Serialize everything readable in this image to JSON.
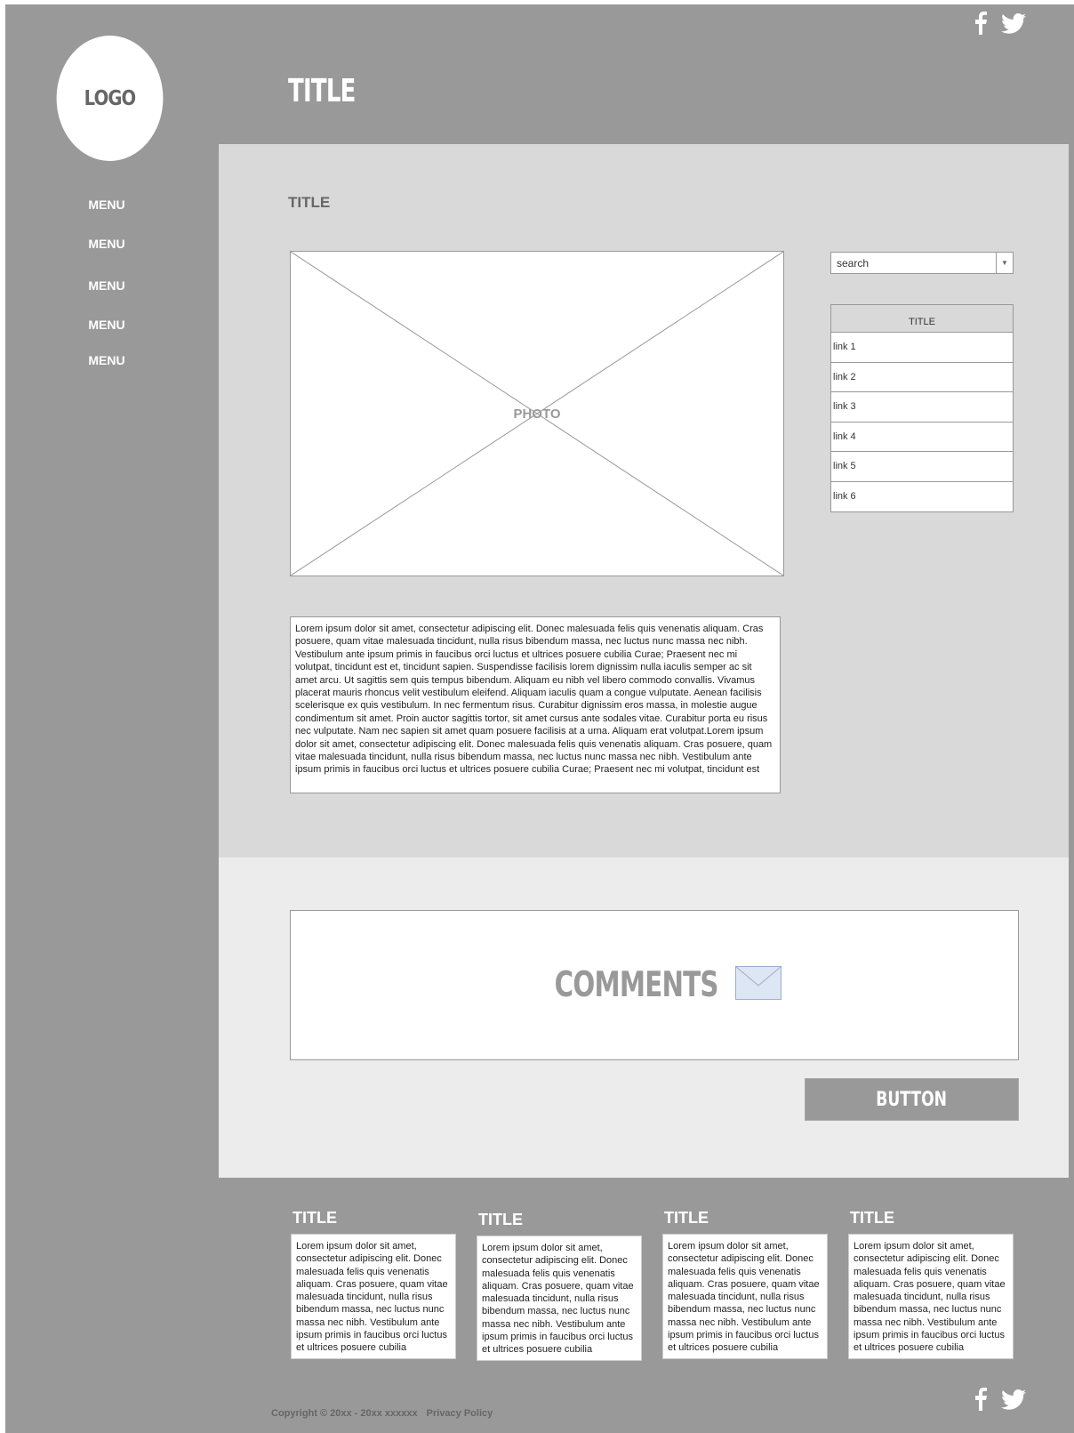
{
  "header": {
    "title": "TITLE",
    "logo": "LOGO"
  },
  "sidebar": {
    "items": [
      {
        "label": "MENU"
      },
      {
        "label": "MENU"
      },
      {
        "label": "MENU"
      },
      {
        "label": "MENU"
      },
      {
        "label": "MENU"
      }
    ]
  },
  "social": {
    "icons": [
      "facebook-icon",
      "twitter-icon"
    ]
  },
  "main": {
    "title": "TITLE",
    "photo_label": "PHOTO",
    "search": {
      "value": "search"
    },
    "links_panel": {
      "title": "TITLE",
      "links": [
        "link 1",
        "link 2",
        "link 3",
        "link 4",
        "link 5",
        "link 6"
      ]
    },
    "body_text": "Lorem ipsum dolor sit amet, consectetur adipiscing elit. Donec malesuada felis quis venenatis aliquam. Cras posuere, quam vitae malesuada tincidunt, nulla risus bibendum massa, nec luctus nunc massa nec nibh. Vestibulum ante ipsum primis in faucibus orci luctus et ultrices posuere cubilia Curae; Praesent nec mi volutpat, tincidunt est et, tincidunt sapien. Suspendisse facilisis lorem dignissim nulla iaculis semper ac sit amet arcu. Ut sagittis sem quis tempus bibendum. Aliquam eu nibh vel libero commodo convallis. Vivamus placerat mauris rhoncus velit vestibulum eleifend. Aliquam iaculis quam a congue vulputate. Aenean facilisis scelerisque ex quis vestibulum. In nec fermentum risus. Curabitur dignissim eros massa, in molestie augue condimentum sit amet. Proin auctor sagittis tortor, sit amet cursus ante sodales vitae. Curabitur porta eu risus nec vulputate. Nam nec sapien sit amet quam posuere facilisis at a urna. Aliquam erat volutpat.Lorem ipsum dolor sit amet, consectetur adipiscing elit. Donec malesuada felis quis venenatis aliquam. Cras posuere, quam vitae malesuada tincidunt, nulla risus bibendum massa, nec luctus nunc massa nec nibh. Vestibulum ante ipsum primis in faucibus orci luctus et ultrices posuere cubilia Curae; Praesent nec mi volutpat, tincidunt est"
  },
  "comments": {
    "label": "COMMENTS",
    "icon": "envelope-icon",
    "button_label": "BUTTON"
  },
  "footer": {
    "columns": [
      {
        "title": "TITLE",
        "text": "Lorem ipsum dolor sit amet, consectetur adipiscing elit. Donec malesuada felis quis venenatis aliquam. Cras posuere, quam vitae malesuada tincidunt, nulla risus bibendum massa, nec luctus nunc massa nec nibh. Vestibulum ante ipsum primis in faucibus orci luctus et ultrices posuere cubilia"
      },
      {
        "title": "TITLE",
        "text": "Lorem ipsum dolor sit amet, consectetur adipiscing elit. Donec malesuada felis quis venenatis aliquam. Cras posuere, quam vitae malesuada tincidunt, nulla risus bibendum massa, nec luctus nunc massa nec nibh. Vestibulum ante ipsum primis in faucibus orci luctus et ultrices posuere cubilia"
      },
      {
        "title": "TITLE",
        "text": "Lorem ipsum dolor sit amet, consectetur adipiscing elit. Donec malesuada felis quis venenatis aliquam. Cras posuere, quam vitae malesuada tincidunt, nulla risus bibendum massa, nec luctus nunc massa nec nibh. Vestibulum ante ipsum primis in faucibus orci luctus et ultrices posuere cubilia"
      },
      {
        "title": "TITLE",
        "text": "Lorem ipsum dolor sit amet, consectetur adipiscing elit. Donec malesuada felis quis venenatis aliquam. Cras posuere, quam vitae malesuada tincidunt, nulla risus bibendum massa, nec luctus nunc massa nec nibh. Vestibulum ante ipsum primis in faucibus orci luctus et ultrices posuere cubilia"
      }
    ],
    "copyright": "Copyright © 20xx - 20xx xxxxxx",
    "privacy": "Privacy Policy"
  },
  "colors": {
    "frame": "#999999",
    "main_bg": "#d9d9d9",
    "comments_bg": "#ececec",
    "panel": "#ffffff"
  }
}
